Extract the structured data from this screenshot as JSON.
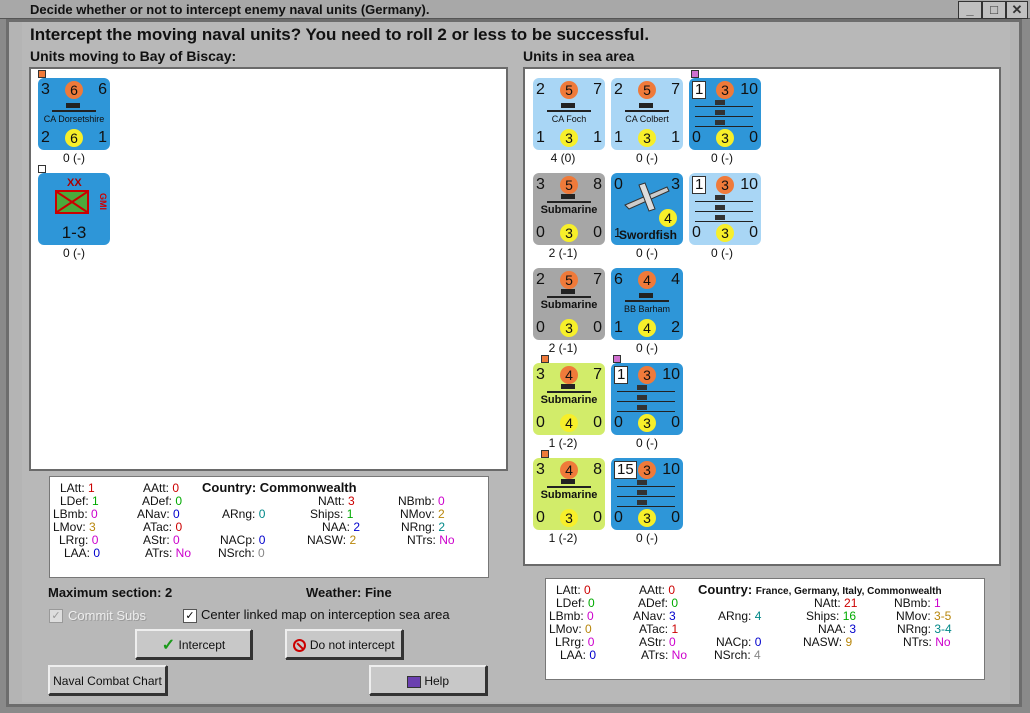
{
  "window": {
    "title": "Decide whether or not to intercept enemy naval units (Germany).",
    "btn_min": "_",
    "btn_max": "□",
    "btn_close": "✕"
  },
  "prompt": "Intercept the moving naval units?  You need to roll 2 or less to be successful.",
  "left_header": "Units moving to Bay of Biscay:",
  "right_header": "Units in sea area",
  "left_units": [
    {
      "name": "CA Dorsetshire",
      "tl": "3",
      "tc": "6",
      "tr": "6",
      "bl": "2",
      "bc": "6",
      "br": "1",
      "val": "0 (-)"
    },
    {
      "name": "1-3",
      "corps": "XX",
      "tag": "GMI",
      "val": "0 (-)"
    }
  ],
  "right_units": [
    {
      "name": "CA Foch",
      "tl": "2",
      "tc": "5",
      "tr": "7",
      "bl": "1",
      "bc": "3",
      "br": "1",
      "val": "4 (0)"
    },
    {
      "name": "CA Colbert",
      "tl": "2",
      "tc": "5",
      "tr": "7",
      "bl": "1",
      "bc": "3",
      "br": "1",
      "val": "0 (-)"
    },
    {
      "name": "",
      "tl": "1",
      "tc": "3",
      "tr": "10",
      "bl": "0",
      "bc": "3",
      "br": "0",
      "val": "0 (-)"
    },
    {
      "name": "Submarine",
      "tl": "3",
      "tc": "5",
      "tr": "8",
      "bl": "0",
      "bc": "3",
      "br": "0",
      "val": "2 (-1)"
    },
    {
      "name": "Swordfish",
      "tl": "0",
      "tc": "4",
      "tr": "3",
      "bl": "1",
      "val": "0 (-)"
    },
    {
      "name": "",
      "tl": "1",
      "tc": "3",
      "tr": "10",
      "bl": "0",
      "bc": "3",
      "br": "0",
      "val": "0 (-)"
    },
    {
      "name": "Submarine",
      "tl": "2",
      "tc": "5",
      "tr": "7",
      "bl": "0",
      "bc": "3",
      "br": "0",
      "val": "2 (-1)"
    },
    {
      "name": "BB Barham",
      "tl": "6",
      "tc": "4",
      "tr": "4",
      "bl": "1",
      "bc": "4",
      "br": "2",
      "val": "0 (-)"
    },
    {
      "name": "Submarine",
      "tl": "3",
      "tc": "4",
      "tr": "7",
      "bl": "0",
      "bc": "4",
      "br": "0",
      "val": "1 (-2)"
    },
    {
      "name": "",
      "tl": "1",
      "tc": "3",
      "tr": "10",
      "bl": "0",
      "bc": "3",
      "br": "0",
      "val": "0 (-)"
    },
    {
      "name": "Submarine",
      "tl": "3",
      "tc": "4",
      "tr": "8",
      "bl": "0",
      "bc": "3",
      "br": "0",
      "val": "1 (-2)"
    },
    {
      "name": "",
      "tl": "15",
      "tc": "3",
      "tr": "10",
      "bl": "0",
      "bc": "3",
      "br": "0",
      "val": "0 (-)"
    }
  ],
  "left_stats": {
    "country_label": "Country:",
    "country": "Commonwealth",
    "LAtt": "1",
    "LDef": "1",
    "LBmb": "0",
    "LMov": "3",
    "LRrg": "0",
    "LAA": "0",
    "AAtt": "0",
    "ADef": "0",
    "ANav": "0",
    "ATac": "0",
    "AStr": "0",
    "ATrs": "No",
    "ARng": "0",
    "NACp": "0",
    "NSrch": "0",
    "NAtt": "3",
    "Ships": "1",
    "NAA": "2",
    "NASW": "2",
    "NBmb": "0",
    "NMov": "2",
    "NRng": "2",
    "NTrs": "No"
  },
  "right_stats": {
    "country_label": "Country:",
    "country": "France, Germany, Italy, Commonwealth",
    "LAtt": "0",
    "LDef": "0",
    "LBmb": "0",
    "LMov": "0",
    "LRrg": "0",
    "LAA": "0",
    "AAtt": "0",
    "ADef": "0",
    "ANav": "3",
    "ATac": "1",
    "AStr": "0",
    "ATrs": "No",
    "ARng": "4",
    "NACp": "0",
    "NSrch": "4",
    "NAtt": "21",
    "Ships": "16",
    "NAA": "3",
    "NASW": "9",
    "NBmb": "1",
    "NMov": "3-5",
    "NRng": "3-4",
    "NTrs": "No"
  },
  "max_section": "Maximum section: 2",
  "weather": "Weather:  Fine",
  "commit_subs": "Commit Subs",
  "center_linked": "Center linked map on interception sea area",
  "buttons": {
    "intercept": "Intercept",
    "no_intercept": "Do not intercept",
    "naval_chart": "Naval Combat Chart",
    "help": "Help"
  }
}
